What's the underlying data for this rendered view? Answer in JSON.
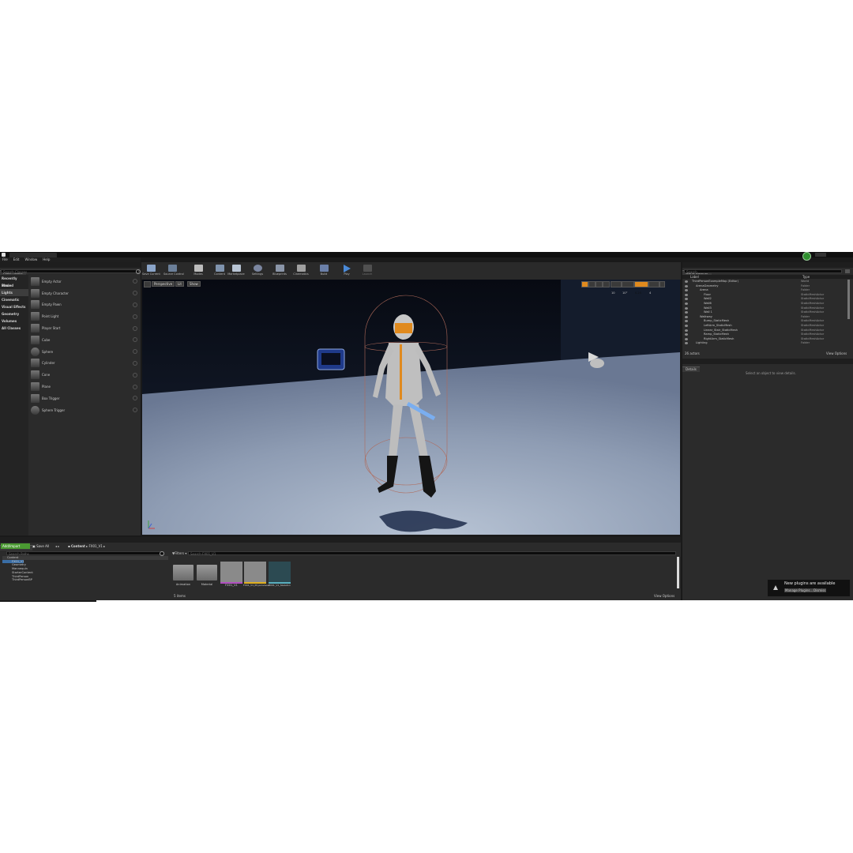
{
  "menu": [
    "File",
    "Edit",
    "Window",
    "Help"
  ],
  "place_actors": {
    "tab": "Place Actors",
    "search_placeholder": "Search Classes",
    "categories": [
      "Recently Placed",
      "Basic",
      "Lights",
      "Cinematic",
      "Visual Effects",
      "Geometry",
      "Volumes",
      "All Classes"
    ],
    "selected_category": "Lights",
    "items": [
      "Empty Actor",
      "Empty Character",
      "Empty Pawn",
      "Point Light",
      "Player Start",
      "Cube",
      "Sphere",
      "Cylinder",
      "Cone",
      "Plane",
      "Box Trigger",
      "Sphere Trigger"
    ]
  },
  "toolbar": {
    "buttons": [
      "Save Current",
      "Source Control",
      "Modes",
      "Content",
      "Marketplace",
      "Settings",
      "Blueprints",
      "Cinematics",
      "Build",
      "Play",
      "Launch"
    ]
  },
  "viewport": {
    "perspective": "Perspective",
    "lit": "Lit",
    "show": "Show",
    "grid_snap": "10",
    "rot_snap": "10°",
    "scale_snap": "0.25",
    "cam_speed": "4"
  },
  "world_outliner": {
    "tab": "World Outliner",
    "search_placeholder": "Search",
    "col_label": "Label",
    "col_type": "Type",
    "rows": [
      {
        "label": "ThirdPersonExampleMap (Editor)",
        "type": "World",
        "indent": 0
      },
      {
        "label": "ArenaGeometry",
        "type": "Folder",
        "indent": 1
      },
      {
        "label": "Arena",
        "type": "Folder",
        "indent": 2
      },
      {
        "label": "Floor",
        "type": "StaticMeshActor",
        "indent": 3
      },
      {
        "label": "Wall2",
        "type": "StaticMeshActor",
        "indent": 3
      },
      {
        "label": "Wall6",
        "type": "StaticMeshActor",
        "indent": 3
      },
      {
        "label": "Wall3",
        "type": "StaticMeshActor",
        "indent": 3
      },
      {
        "label": "Wall 1",
        "type": "StaticMeshActor",
        "indent": 3
      },
      {
        "label": "Walkway",
        "type": "Folder",
        "indent": 2
      },
      {
        "label": "Bump_StaticMesh",
        "type": "StaticMeshActor",
        "indent": 3
      },
      {
        "label": "LeftArm_StaticMesh",
        "type": "StaticMeshActor",
        "indent": 3
      },
      {
        "label": "Linear_Stair_StaticMesh",
        "type": "StaticMeshActor",
        "indent": 3
      },
      {
        "label": "Ramp_StaticMesh",
        "type": "StaticMeshActor",
        "indent": 3
      },
      {
        "label": "RightArm_StaticMesh",
        "type": "StaticMeshActor",
        "indent": 3
      },
      {
        "label": "Lighting",
        "type": "Folder",
        "indent": 1
      }
    ],
    "actor_count": "26 actors",
    "view_options": "View Options"
  },
  "details": {
    "tab": "Details",
    "empty_message": "Select an object to view details."
  },
  "content_browser": {
    "tab": "Content Browser",
    "add_import": "Add/Import",
    "save_all": "Save All",
    "path": [
      "Content",
      "FX01_V1"
    ],
    "search_paths": "Search Paths",
    "tree": [
      "Content",
      "FX01_V1",
      "Geometry",
      "Mannequin",
      "StarterContent",
      "ThirdPerson",
      "ThirdPersonBP"
    ],
    "filters": "Filters",
    "search_placeholder": "Search FX01_V1",
    "assets": [
      {
        "label": "Animation",
        "kind": "folder"
      },
      {
        "label": "Material",
        "kind": "folder"
      },
      {
        "label": "FX01_V1",
        "kind": "mesh"
      },
      {
        "label": "FX01_V1_PhysicsAsset",
        "kind": "physics"
      },
      {
        "label": "FX01_V1_Skeleton",
        "kind": "skeleton"
      }
    ],
    "item_count": "5 items",
    "view_options": "View Options"
  },
  "notification": {
    "title": "New plugins are available",
    "manage": "Manage Plugins...",
    "dismiss": "Dismiss"
  },
  "colors": {
    "accent_orange": "#e08a1e",
    "selection_blue": "#3a6ea5",
    "add_green": "#4a9a32",
    "play_blue": "#4a8ad8"
  }
}
